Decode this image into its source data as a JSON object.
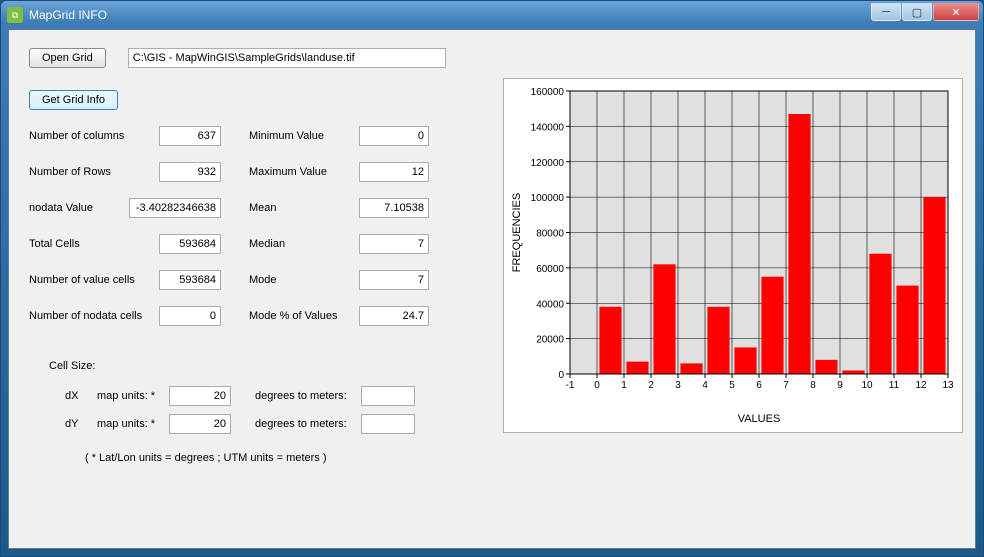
{
  "window": {
    "title": "MapGrid INFO"
  },
  "toolbar": {
    "open_grid": "Open Grid",
    "file_path": "C:\\GIS - MapWinGIS\\SampleGrids\\landuse.tif",
    "get_grid_info": "Get Grid Info"
  },
  "stats": {
    "num_cols_label": "Number of columns",
    "num_cols": "637",
    "num_rows_label": "Number of  Rows",
    "num_rows": "932",
    "nodata_label": "nodata Value",
    "nodata": "-3.40282346638",
    "total_cells_label": "Total Cells",
    "total_cells": "593684",
    "value_cells_label": "Number of  value cells",
    "value_cells": "593684",
    "nodata_cells_label": "Number of  nodata cells",
    "nodata_cells": "0",
    "min_label": "Minimum Value",
    "min": "0",
    "max_label": "Maximum Value",
    "max": "12",
    "mean_label": "Mean",
    "mean": "7.10538",
    "median_label": "Median",
    "median": "7",
    "mode_label": "Mode",
    "mode": "7",
    "mode_pct_label": "Mode % of Values",
    "mode_pct": "24.7"
  },
  "cellsize": {
    "header": "Cell Size:",
    "dx_label": "dX",
    "dy_label": "dY",
    "mapunits": "map units: *",
    "dx": "20",
    "dy": "20",
    "deg_to_m": "degrees to meters:",
    "dx_m": "",
    "dy_m": "",
    "note": "( * Lat/Lon units = degrees ;   UTM units = meters )"
  },
  "chart_data": {
    "type": "bar",
    "title": "",
    "xlabel": "VALUES",
    "ylabel": "FREQUENCIES",
    "categories": [
      0,
      1,
      2,
      3,
      4,
      5,
      6,
      7,
      8,
      9,
      10,
      11,
      12
    ],
    "values": [
      38000,
      7000,
      62000,
      6000,
      38000,
      15000,
      55000,
      147000,
      8000,
      2000,
      68000,
      50000,
      100000
    ],
    "xlim": [
      -1,
      13
    ],
    "ylim": [
      0,
      160000
    ],
    "yticks": [
      0,
      20000,
      40000,
      60000,
      80000,
      100000,
      120000,
      140000,
      160000
    ],
    "xticks": [
      -1,
      0,
      1,
      2,
      3,
      4,
      5,
      6,
      7,
      8,
      9,
      10,
      11,
      12,
      13
    ],
    "bar_color": "#ff0000",
    "plot_bg": "#e0e0e0"
  }
}
